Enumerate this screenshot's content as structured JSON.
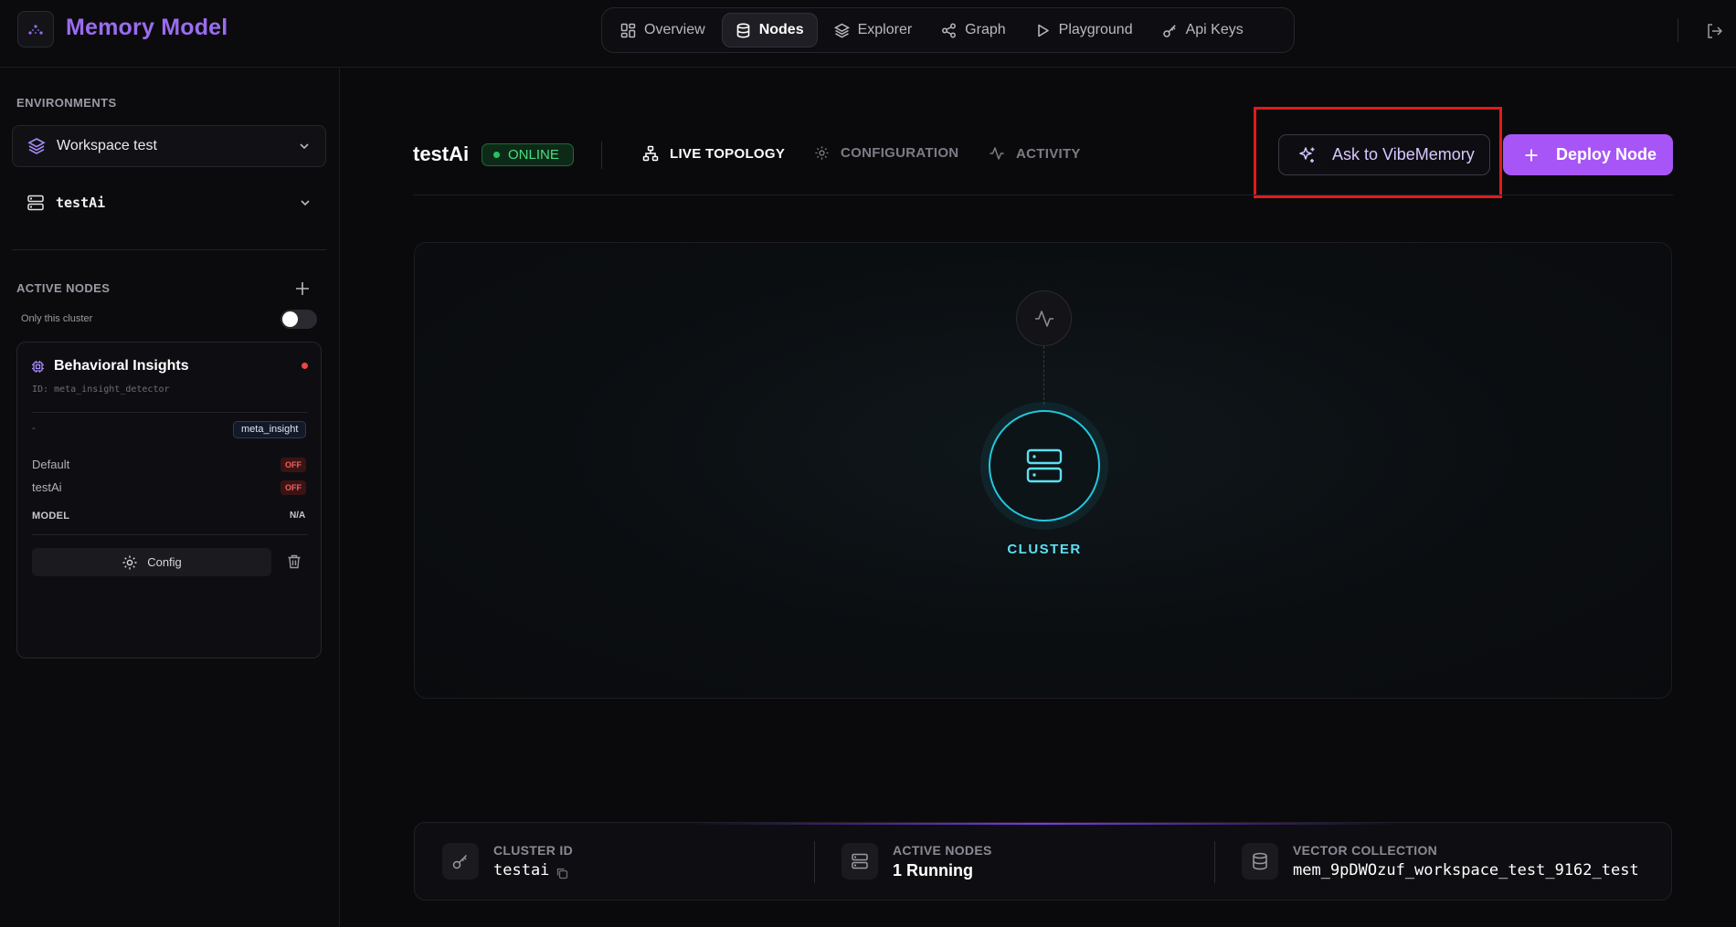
{
  "header": {
    "brand": "Memory Model",
    "nav": [
      {
        "label": "Overview"
      },
      {
        "label": "Nodes"
      },
      {
        "label": "Explorer"
      },
      {
        "label": "Graph"
      },
      {
        "label": "Playground"
      },
      {
        "label": "Api Keys"
      }
    ]
  },
  "sidebar": {
    "environments_label": "ENVIRONMENTS",
    "environment": "Workspace test",
    "cluster": "testAi",
    "active_nodes_label": "ACTIVE NODES",
    "only_cluster_label": "Only this cluster",
    "node": {
      "title": "Behavioral Insights",
      "id": "ID: meta_insight_detector",
      "dash": "-",
      "tag": "meta_insight",
      "rows": [
        {
          "label": "Default",
          "status": "OFF"
        },
        {
          "label": "testAi",
          "status": "OFF"
        }
      ],
      "model_label": "MODEL",
      "model_value": "N/A",
      "config_label": "Config"
    }
  },
  "main": {
    "title": "testAi",
    "status": "ONLINE",
    "tabs": [
      {
        "label": "LIVE TOPOLOGY"
      },
      {
        "label": "CONFIGURATION"
      },
      {
        "label": "ACTIVITY"
      }
    ],
    "ask_label": "Ask to VibeMemory",
    "deploy_label": "Deploy Node",
    "cluster_label": "CLUSTER"
  },
  "stats": [
    {
      "label": "CLUSTER ID",
      "value": "testai"
    },
    {
      "label": "ACTIVE NODES",
      "value": "1 Running"
    },
    {
      "label": "VECTOR COLLECTION",
      "value": "mem_9pDWOzuf_workspace_test_9162_test"
    }
  ],
  "colors": {
    "accent": "#a855f7",
    "brand": "#9b6cf0",
    "online": "#22c55e",
    "cluster": "#22c7dd",
    "off": "#f26060"
  }
}
